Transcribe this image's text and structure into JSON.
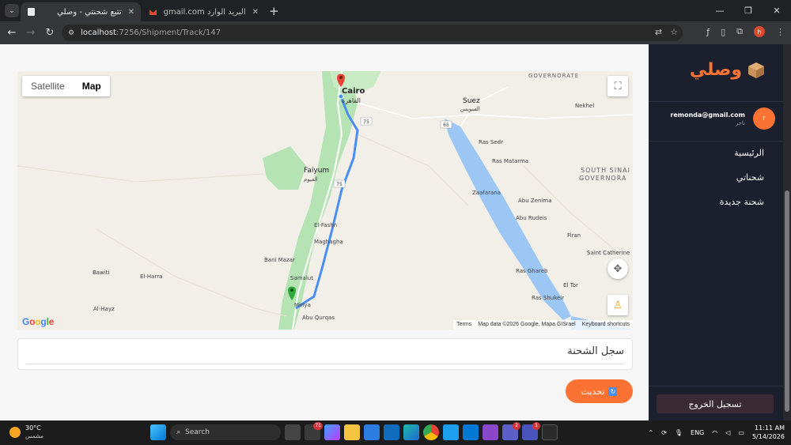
{
  "browser": {
    "tabs": [
      {
        "title": "تتبع شحنتي - وصلي",
        "active": true
      },
      {
        "title": "البريد الوارد Gmail - gmail.com@",
        "active": false
      }
    ],
    "url_host": "localhost",
    "url_path": ":7256/Shipment/Track/147",
    "profile_initial": "h"
  },
  "map": {
    "type_options": [
      "Satellite",
      "Map"
    ],
    "selected_type": "Map",
    "labels": {
      "cairo": "Cairo",
      "cairo_ar": "القاهرة",
      "suez": "Suez",
      "suez_ar": "السويس",
      "faiyum": "Faiyum",
      "faiyum_ar": "الفيوم",
      "governorate": "GOVERNORATE",
      "south_sinai": "SOUTH SINAI",
      "south_sinai_gov": "GOVERNORA",
      "ras_sedr": "Ras Sedr",
      "ras_matarma": "Ras Matarma",
      "zaafarana": "Zaafarana",
      "abu_zenima": "Abu Zenima",
      "abu_rudeis": "Abu Rudeis",
      "ras_gharib": "Ras Ghareb",
      "ras_shukeir": "Ras Shukeir",
      "el_fashn": "El-Fashn",
      "maghagha": "Maghagha",
      "bani_mazar": "Bani Mazar",
      "samalut": "Samalut",
      "minya": "Minya",
      "abu_qurqas": "Abu Qurqas",
      "bawiti": "Bawiti",
      "el_harra": "El-Harra",
      "al_hayz": "Al-Hayz",
      "nekhel": "Nekhel",
      "firan": "Firan",
      "st_catherine": "Saint Catherine",
      "el_tor": "El Tor"
    },
    "road_numbers": [
      "75",
      "65",
      "75"
    ],
    "footer": [
      "Terms",
      "Map data ©2026 Google, Mapa GISrael",
      "Keyboard shortcuts"
    ],
    "google_logo": "Google"
  },
  "history": {
    "title": "سجل الشحنة"
  },
  "refresh_button": "تحديث",
  "sidebar": {
    "brand": "وصلي",
    "user_email": "remonda@gmail.com",
    "user_role": "تاجر",
    "avatar_initial": "r",
    "nav": [
      "الرئيسية",
      "شحناتي",
      "شحنة جديدة"
    ],
    "logout": "تسجيل الخروج"
  },
  "taskbar": {
    "temperature": "30°C",
    "weather": "مشمس",
    "search": "Search",
    "lang": "ENG",
    "time": "11:11 AM",
    "date": "5/14/2026",
    "badges": [
      "71",
      "2",
      "1"
    ]
  },
  "colors": {
    "accent": "#fb7233",
    "sidebar_bg": "#1b1f2e",
    "route": "#4a8ff0",
    "water": "#9cc7f5",
    "green": "#b6e3b4"
  }
}
